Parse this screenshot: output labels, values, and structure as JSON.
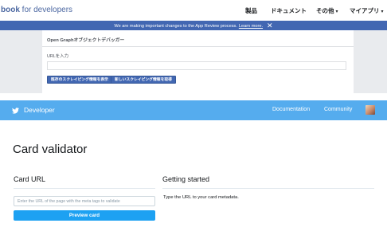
{
  "fb_header": {
    "brand_partial": "book",
    "brand_suffix": " for developers",
    "nav": [
      {
        "label": "製品",
        "caret": ""
      },
      {
        "label": "ドキュメント",
        "caret": ""
      },
      {
        "label": "その他",
        "caret": "▾"
      },
      {
        "label": "マイアプリ",
        "caret": "▾"
      }
    ]
  },
  "fb_notice": {
    "text": "We are making important changes to the App Review process.",
    "link": "Learn more.",
    "close_icon": "close-icon"
  },
  "og_debugger": {
    "title": "Open Graphオブジェクトデバッガー",
    "url_label": "URLを入力",
    "url_value": "",
    "buttons": [
      "既存のスクレイピング情報を表示",
      "新しいスクレイピング情報を取得"
    ],
    "colors": {
      "button": "#4267b2",
      "notice": "#4267b2"
    }
  },
  "twitter_header": {
    "title": "Developer",
    "nav": [
      "Documentation",
      "Community"
    ],
    "icons": [
      "twitter-bird-icon",
      "user-avatar"
    ],
    "color": "#55acee"
  },
  "card_validator": {
    "page_title": "Card validator",
    "card_url_heading": "Card URL",
    "url_placeholder": "Enter the URL of the page with the meta tags to validate",
    "url_value": "",
    "preview_button": "Preview card",
    "getting_started_heading": "Getting started",
    "getting_started_text": "Type the URL to your card metadata.",
    "colors": {
      "button": "#1da1f2"
    }
  }
}
